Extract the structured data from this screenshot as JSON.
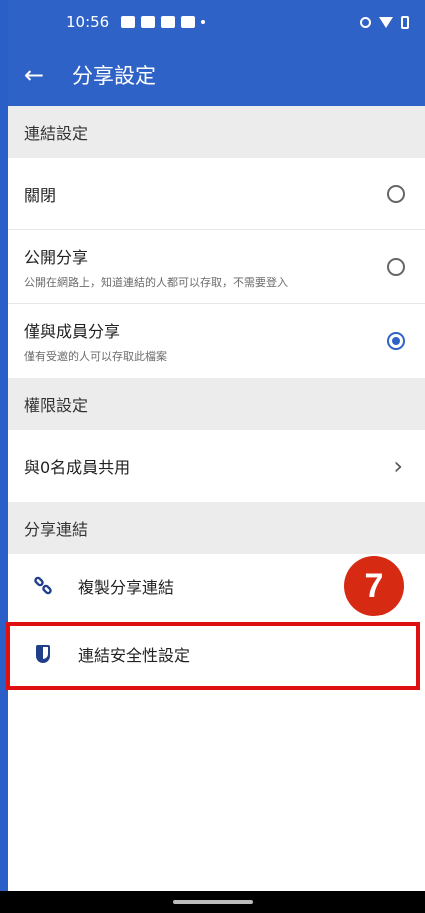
{
  "status_bar": {
    "time": "10:56"
  },
  "app_bar": {
    "title": "分享設定"
  },
  "sections": {
    "link_settings": "連結設定",
    "permission_settings": "權限設定",
    "share_link": "分享連結"
  },
  "options": {
    "off": {
      "title": "關閉",
      "checked": false
    },
    "public": {
      "title": "公開分享",
      "subtitle": "公開在網路上，知道連結的人都可以存取，不需要登入",
      "checked": false
    },
    "members": {
      "title": "僅與成員分享",
      "subtitle": "僅有受邀的人可以存取此檔案",
      "checked": true
    }
  },
  "members_row": {
    "label": "與0名成員共用"
  },
  "actions": {
    "copy_link": {
      "label": "複製分享連結",
      "icon": "link-icon"
    },
    "link_security": {
      "label": "連結安全性設定",
      "icon": "shield-icon"
    }
  },
  "annotation": {
    "step": "7",
    "accent": "#d62b12"
  },
  "colors": {
    "primary": "#2f62c6",
    "highlight": "#e01010"
  }
}
